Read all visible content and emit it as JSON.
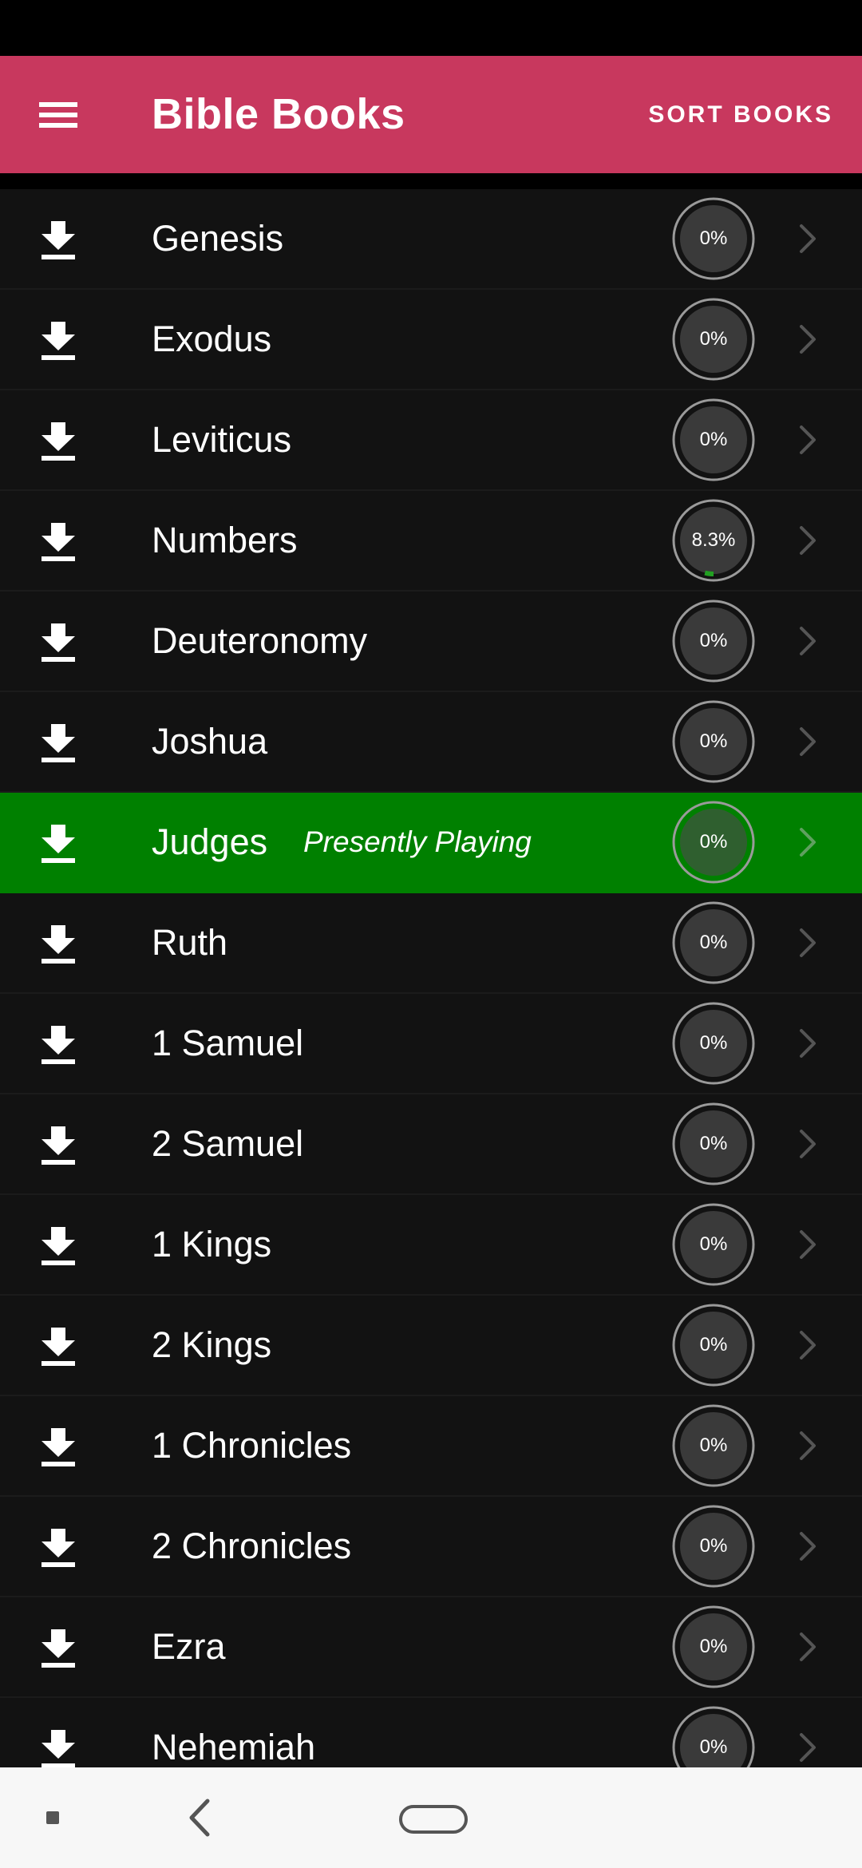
{
  "colors": {
    "accent": "#c8385e",
    "playing": "#008000",
    "progress_fill": "#22a022"
  },
  "icons": {
    "menu": "hamburger-menu-icon",
    "download": "download-icon",
    "chevron": "chevron-right-icon"
  },
  "app_bar": {
    "title": "Bible Books",
    "sort_label": "SORT BOOKS"
  },
  "playing_label": "Presently Playing",
  "books": [
    {
      "name": "Genesis",
      "progress": "0%",
      "progress_fraction": 0,
      "playing": false
    },
    {
      "name": "Exodus",
      "progress": "0%",
      "progress_fraction": 0,
      "playing": false
    },
    {
      "name": "Leviticus",
      "progress": "0%",
      "progress_fraction": 0,
      "playing": false
    },
    {
      "name": "Numbers",
      "progress": "8.3%",
      "progress_fraction": 0.083,
      "playing": false
    },
    {
      "name": "Deuteronomy",
      "progress": "0%",
      "progress_fraction": 0,
      "playing": false
    },
    {
      "name": "Joshua",
      "progress": "0%",
      "progress_fraction": 0,
      "playing": false
    },
    {
      "name": "Judges",
      "progress": "0%",
      "progress_fraction": 0,
      "playing": true
    },
    {
      "name": "Ruth",
      "progress": "0%",
      "progress_fraction": 0,
      "playing": false
    },
    {
      "name": "1 Samuel",
      "progress": "0%",
      "progress_fraction": 0,
      "playing": false
    },
    {
      "name": "2 Samuel",
      "progress": "0%",
      "progress_fraction": 0,
      "playing": false
    },
    {
      "name": "1 Kings",
      "progress": "0%",
      "progress_fraction": 0,
      "playing": false
    },
    {
      "name": "2 Kings",
      "progress": "0%",
      "progress_fraction": 0,
      "playing": false
    },
    {
      "name": "1 Chronicles",
      "progress": "0%",
      "progress_fraction": 0,
      "playing": false
    },
    {
      "name": "2 Chronicles",
      "progress": "0%",
      "progress_fraction": 0,
      "playing": false
    },
    {
      "name": "Ezra",
      "progress": "0%",
      "progress_fraction": 0,
      "playing": false
    },
    {
      "name": "Nehemiah",
      "progress": "0%",
      "progress_fraction": 0,
      "playing": false
    }
  ]
}
